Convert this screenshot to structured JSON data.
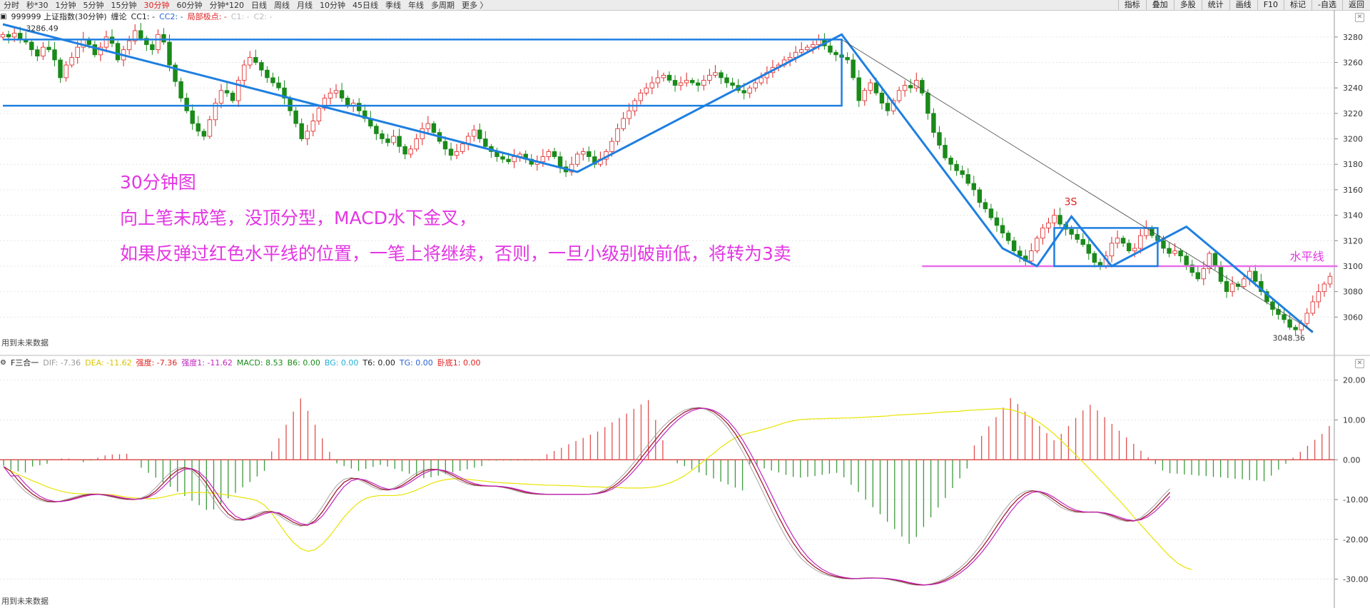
{
  "toolbar": {
    "periods": [
      "分时",
      "秒*30",
      "1分钟",
      "5分钟",
      "15分钟",
      "30分钟",
      "60分钟",
      "分钟*120",
      "日线",
      "周线",
      "月线",
      "10分钟",
      "45日线",
      "季线",
      "年线",
      "多周期",
      "更多 〉"
    ],
    "active": "30分钟",
    "right_buttons": [
      "指标",
      "叠加",
      "多股",
      "统计",
      "画线",
      "F10",
      "标记",
      "-自选",
      "返回"
    ]
  },
  "kline_info": [
    {
      "text": "999999 上证指数(30分钟)",
      "color": "#222222"
    },
    {
      "text": "缠论",
      "color": "#222222"
    },
    {
      "text": "CC1: -",
      "color": "#222222"
    },
    {
      "text": "CC2: -",
      "color": "#2a62d4"
    },
    {
      "text": "局部极点: -",
      "color": "#e02020"
    },
    {
      "text": "C1: -",
      "color": "#bbbbbb"
    },
    {
      "text": "C2: -",
      "color": "#bbbbbb"
    }
  ],
  "macd_info": [
    {
      "text": "F三合一",
      "color": "#222222"
    },
    {
      "text": "DIF: -7.36",
      "color": "#999999"
    },
    {
      "text": "DEA: -11.62",
      "color": "#d9c300"
    },
    {
      "text": "强度: -7.36",
      "color": "#e02020"
    },
    {
      "text": "强度1: -11.62",
      "color": "#c026c0"
    },
    {
      "text": "MACD: 8.53",
      "color": "#1a8a1a"
    },
    {
      "text": "B6: 0.00",
      "color": "#1a8a1a"
    },
    {
      "text": "BG: 0.00",
      "color": "#20b0d8"
    },
    {
      "text": "T6: 0.00",
      "color": "#222222"
    },
    {
      "text": "TG: 0.00",
      "color": "#2a62d4"
    },
    {
      "text": "卧底1: 0.00",
      "color": "#e02020"
    }
  ],
  "annotations": [
    "30分钟图",
    "向上笔未成笔，没顶分型，MACD水下金叉，",
    "如果反弹过红色水平线的位置，一笔上将继续，否则，一旦小级别破前低，将转为3卖"
  ],
  "footer_text": "用到未来数据",
  "colors": {
    "up": "#e02020",
    "down": "#1a8a1a",
    "blue": "#1e7fe0",
    "magenta": "#e336e3",
    "yellow": "#e8e830"
  },
  "chart_data": [
    {
      "type": "candlestick",
      "title": "999999 上证指数(30分钟)",
      "ylim": [
        3040,
        3290
      ],
      "yticks": [
        3060,
        3080,
        3100,
        3120,
        3140,
        3160,
        3180,
        3200,
        3220,
        3240,
        3260,
        3280
      ],
      "price_labels": [
        {
          "text": "3286.49",
          "value": 3286.49
        },
        {
          "text": "3048.36",
          "value": 3048.36
        },
        {
          "text": "3S",
          "value": 3140
        },
        {
          "text": "水平线",
          "value": 3100
        }
      ],
      "horizontal_line": {
        "name": "水平线",
        "value": 3100
      },
      "closes": [
        3282,
        3280,
        3283,
        3278,
        3276,
        3270,
        3265,
        3272,
        3270,
        3262,
        3248,
        3258,
        3264,
        3272,
        3278,
        3274,
        3266,
        3272,
        3280,
        3275,
        3262,
        3270,
        3277,
        3285,
        3279,
        3274,
        3270,
        3282,
        3276,
        3258,
        3245,
        3232,
        3222,
        3212,
        3206,
        3202,
        3215,
        3228,
        3238,
        3236,
        3230,
        3246,
        3258,
        3264,
        3260,
        3254,
        3248,
        3244,
        3240,
        3232,
        3222,
        3212,
        3200,
        3206,
        3214,
        3224,
        3232,
        3236,
        3238,
        3232,
        3226,
        3228,
        3222,
        3216,
        3210,
        3204,
        3200,
        3197,
        3202,
        3194,
        3188,
        3192,
        3200,
        3208,
        3212,
        3205,
        3198,
        3192,
        3187,
        3190,
        3196,
        3202,
        3207,
        3200,
        3194,
        3190,
        3186,
        3184,
        3182,
        3186,
        3188,
        3184,
        3180,
        3182,
        3186,
        3190,
        3186,
        3178,
        3174,
        3180,
        3188,
        3190,
        3186,
        3180,
        3184,
        3190,
        3198,
        3208,
        3216,
        3222,
        3230,
        3236,
        3240,
        3244,
        3248,
        3250,
        3246,
        3242,
        3244,
        3246,
        3244,
        3242,
        3246,
        3250,
        3252,
        3248,
        3244,
        3242,
        3238,
        3236,
        3240,
        3244,
        3248,
        3252,
        3256,
        3258,
        3262,
        3264,
        3268,
        3270,
        3272,
        3274,
        3278,
        3273,
        3268,
        3266,
        3264,
        3262,
        3248,
        3230,
        3238,
        3244,
        3236,
        3228,
        3222,
        3230,
        3238,
        3242,
        3240,
        3246,
        3236,
        3220,
        3205,
        3195,
        3185,
        3180,
        3175,
        3172,
        3165,
        3160,
        3150,
        3145,
        3138,
        3132,
        3126,
        3120,
        3112,
        3108,
        3104,
        3112,
        3122,
        3130,
        3134,
        3140,
        3133,
        3129,
        3125,
        3121,
        3117,
        3110,
        3103,
        3100,
        3108,
        3118,
        3122,
        3118,
        3112,
        3114,
        3124,
        3130,
        3124,
        3120,
        3114,
        3110,
        3112,
        3108,
        3101,
        3095,
        3090,
        3098,
        3110,
        3100,
        3088,
        3080,
        3086,
        3084,
        3090,
        3096,
        3088,
        3080,
        3072,
        3066,
        3062,
        3058,
        3052,
        3050,
        3055,
        3063,
        3072,
        3080,
        3086,
        3092
      ]
    },
    {
      "type": "bar",
      "title": "F三合一",
      "ylim": [
        -36,
        23
      ],
      "yticks": [
        -30,
        -20,
        -10,
        0,
        10,
        20
      ],
      "macd_values": [
        -1.5,
        -2.6,
        -2.9,
        -3.2,
        -1.7,
        -1.4,
        -1.0,
        0.1,
        0.3,
        0.3,
        0.1,
        -0.6,
        -0.2,
        0.5,
        1.1,
        1.3,
        1.4,
        1.5,
        0.0,
        -2.0,
        -3.3,
        -4.5,
        -5.7,
        -6.8,
        -8.0,
        -9.1,
        -10.3,
        -11.4,
        -12.6,
        -12.5,
        -11.1,
        -9.7,
        -8.3,
        -6.9,
        -5.6,
        -4.2,
        -2.8,
        2.1,
        5.4,
        8.8,
        12.1,
        15.4,
        12.3,
        8.8,
        5.4,
        2.0,
        -0.9,
        -1.6,
        -2.2,
        -2.8,
        -2.3,
        -1.8,
        -1.3,
        -1.7,
        -2.3,
        -2.9,
        -3.5,
        -4.0,
        -4.6,
        -4.4,
        -4.0,
        -3.6,
        -3.2,
        -2.8,
        -2.4,
        -2.0,
        -1.6,
        -0.2,
        -0.2,
        -0.2,
        -0.2,
        -0.2,
        -0.2,
        -0.2,
        -0.2,
        1.4,
        2.2,
        3.0,
        3.9,
        4.7,
        5.5,
        6.3,
        7.1,
        8.2,
        9.4,
        10.5,
        11.6,
        12.8,
        13.9,
        15.0,
        10.0,
        4.9,
        -0.1,
        -0.9,
        -1.6,
        -2.4,
        -3.2,
        -3.9,
        -4.7,
        -5.5,
        -6.2,
        -7.0,
        -7.7,
        -1.1,
        -1.6,
        -2.2,
        -2.7,
        -3.2,
        -3.8,
        -4.3,
        -4.5,
        -4.3,
        -4.1,
        -3.8,
        -3.5,
        -3.3,
        -4.4,
        -6.3,
        -8.1,
        -10.0,
        -11.9,
        -13.7,
        -15.6,
        -17.4,
        -19.3,
        -21.1,
        -19.4,
        -16.9,
        -14.5,
        -12.0,
        -9.6,
        -7.1,
        -4.7,
        -2.2,
        3.6,
        6.0,
        8.4,
        10.7,
        13.1,
        15.5,
        14.0,
        12.1,
        10.3,
        8.5,
        6.7,
        4.9,
        6.5,
        8.5,
        10.5,
        12.4,
        13.8,
        12.4,
        10.7,
        9.0,
        7.3,
        5.6,
        4.0,
        2.3,
        0.6,
        -1.1,
        -2.7,
        -3.4,
        -3.5,
        -3.7,
        -3.8,
        -4.0,
        -4.1,
        -4.3,
        -4.4,
        -4.6,
        -4.8,
        -4.9,
        -5.1,
        -5.2,
        -5.4,
        -4.0,
        -2.5,
        -1.0,
        0.5,
        2.0,
        3.5,
        5.0,
        6.5,
        8.5
      ],
      "dif_values": [
        -1.7,
        -4.1,
        -6.2,
        -8.0,
        -9.3,
        -10.2,
        -10.6,
        -10.6,
        -10.3,
        -9.8,
        -9.2,
        -8.8,
        -8.6,
        -8.7,
        -9.0,
        -9.4,
        -9.8,
        -10.0,
        -10.0,
        -9.6,
        -8.7,
        -7.0,
        -5.0,
        -3.2,
        -2.1,
        -1.9,
        -2.7,
        -4.6,
        -7.2,
        -10.1,
        -12.7,
        -14.5,
        -15.3,
        -15.1,
        -14.4,
        -13.5,
        -12.9,
        -13.1,
        -14.0,
        -15.2,
        -16.2,
        -16.7,
        -16.2,
        -14.4,
        -11.8,
        -8.9,
        -6.4,
        -4.9,
        -4.5,
        -5.0,
        -5.9,
        -6.9,
        -7.6,
        -7.6,
        -7.0,
        -5.9,
        -4.6,
        -3.3,
        -2.5,
        -2.3,
        -2.6,
        -3.4,
        -4.4,
        -5.4,
        -6.1,
        -6.5,
        -6.6,
        -6.6,
        -6.7,
        -7.0,
        -7.4,
        -8.0,
        -8.4,
        -8.6,
        -8.7,
        -8.7,
        -8.7,
        -8.7,
        -8.7,
        -8.7,
        -8.7,
        -8.6,
        -8.3,
        -7.5,
        -6.4,
        -4.8,
        -2.9,
        -0.7,
        1.6,
        3.9,
        6.2,
        8.3,
        10.0,
        11.4,
        12.5,
        13.0,
        13.1,
        12.6,
        11.6,
        10.0,
        7.9,
        5.2,
        2.1,
        -1.4,
        -5.0,
        -8.8,
        -12.6,
        -16.2,
        -19.5,
        -22.3,
        -24.6,
        -26.3,
        -27.6,
        -28.6,
        -29.2,
        -29.6,
        -29.9,
        -29.9,
        -29.8,
        -29.7,
        -29.7,
        -29.8,
        -30.0,
        -30.4,
        -30.8,
        -31.3,
        -31.5,
        -31.5,
        -31.2,
        -30.6,
        -29.8,
        -28.6,
        -27.2,
        -25.5,
        -23.4,
        -21.1,
        -18.4,
        -15.6,
        -13.0,
        -10.7,
        -9.0,
        -7.9,
        -7.7,
        -8.3,
        -9.4,
        -10.7,
        -12.0,
        -12.8,
        -13.2,
        -13.2,
        -13.1,
        -13.2,
        -13.7,
        -14.4,
        -15.1,
        -15.5,
        -15.3,
        -14.5,
        -13.0,
        -11.2,
        -9.1,
        -7.3
      ],
      "dea_values": [
        -2.0,
        -2.8,
        -3.7,
        -4.5,
        -5.3,
        -6.0,
        -6.8,
        -7.4,
        -7.9,
        -8.3,
        -8.5,
        -8.6,
        -8.6,
        -8.6,
        -8.7,
        -8.8,
        -9.1,
        -9.4,
        -9.6,
        -9.7,
        -9.8,
        -9.7,
        -9.4,
        -9.0,
        -8.6,
        -8.4,
        -8.2,
        -8.2,
        -8.3,
        -8.4,
        -8.6,
        -8.9,
        -9.2,
        -9.5,
        -9.8,
        -10.3,
        -11.4,
        -13.4,
        -16.0,
        -18.6,
        -20.8,
        -22.3,
        -23.0,
        -22.6,
        -21.2,
        -19.2,
        -16.8,
        -14.4,
        -12.4,
        -10.8,
        -9.7,
        -9.2,
        -9.0,
        -9.0,
        -9.0,
        -8.8,
        -8.3,
        -7.6,
        -6.8,
        -6.0,
        -5.4,
        -5.0,
        -4.8,
        -4.8,
        -4.9,
        -5.1,
        -5.3,
        -5.5,
        -5.7,
        -5.8,
        -5.9,
        -6.0,
        -6.1,
        -6.2,
        -6.3,
        -6.4,
        -6.4,
        -6.5,
        -6.5,
        -6.6,
        -6.7,
        -6.8,
        -6.8,
        -6.9,
        -6.9,
        -7.0,
        -7.1,
        -7.1,
        -7.1,
        -7.0,
        -6.8,
        -6.4,
        -5.8,
        -5.0,
        -4.0,
        -2.7,
        -1.3,
        0.2,
        1.6,
        3.1,
        4.4,
        5.5,
        6.3,
        6.8,
        7.2,
        7.7,
        8.2,
        8.8,
        9.4,
        9.8,
        10.1,
        10.2,
        10.3,
        10.3,
        10.4,
        10.4,
        10.5,
        10.5,
        10.6,
        10.7,
        10.8,
        10.9,
        11.0,
        11.2,
        11.3,
        11.4,
        11.5,
        11.6,
        11.7,
        11.9,
        12.0,
        12.1,
        12.2,
        12.4,
        12.5,
        12.6,
        12.7,
        12.8,
        12.8,
        12.6,
        12.1,
        11.4,
        10.5,
        9.3,
        8.0,
        6.5,
        4.8,
        3.0,
        1.2,
        -0.6,
        -2.5,
        -4.4,
        -6.3,
        -8.3,
        -10.2,
        -12.2,
        -14.3,
        -16.4,
        -18.4,
        -20.4,
        -22.4,
        -24.3,
        -25.9,
        -27.0,
        -27.6
      ]
    }
  ]
}
